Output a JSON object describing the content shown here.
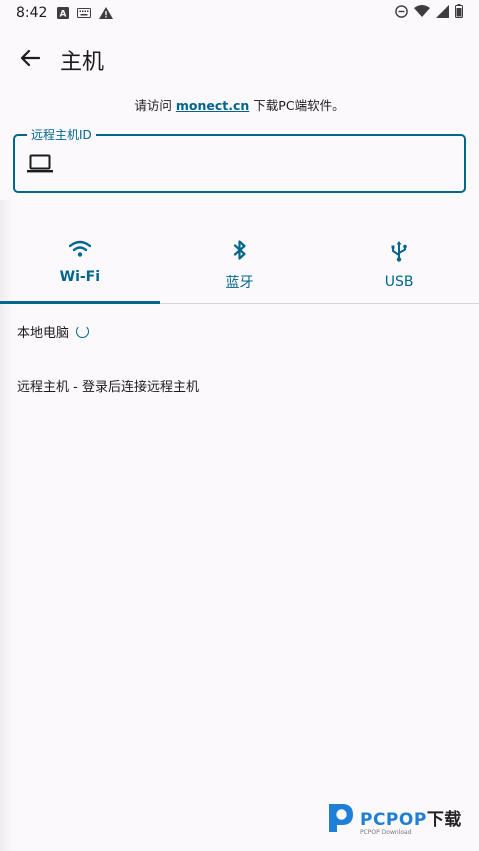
{
  "status_bar": {
    "time": "8:42",
    "icons_left": [
      "a-box-icon",
      "keyboard-icon",
      "warning-icon"
    ],
    "icons_right": [
      "do-not-disturb-icon",
      "wifi-icon",
      "signal-icon",
      "battery-icon"
    ]
  },
  "app_bar": {
    "title": "主机",
    "back_icon": "arrow-back-icon"
  },
  "visit": {
    "prefix": "请访问 ",
    "link": "monect.cn",
    "suffix": " 下载PC端软件。"
  },
  "remote_id_field": {
    "label": "远程主机ID",
    "value": "",
    "icon": "laptop-icon"
  },
  "tabs": [
    {
      "label": "Wi-Fi",
      "icon": "wifi-icon",
      "selected": true
    },
    {
      "label": "蓝牙",
      "icon": "bluetooth-icon",
      "selected": false
    },
    {
      "label": "USB",
      "icon": "usb-icon",
      "selected": false
    }
  ],
  "list": {
    "local_pc": "本地电脑",
    "remote_host": "远程主机 - 登录后连接远程主机"
  },
  "watermark": {
    "brand": "PCPOP",
    "brand_cn": "下载",
    "sub": "PCPOP Download"
  },
  "colors": {
    "accent": "#00668b",
    "background": "#fcf9fd",
    "text": "#1b1b1f"
  }
}
